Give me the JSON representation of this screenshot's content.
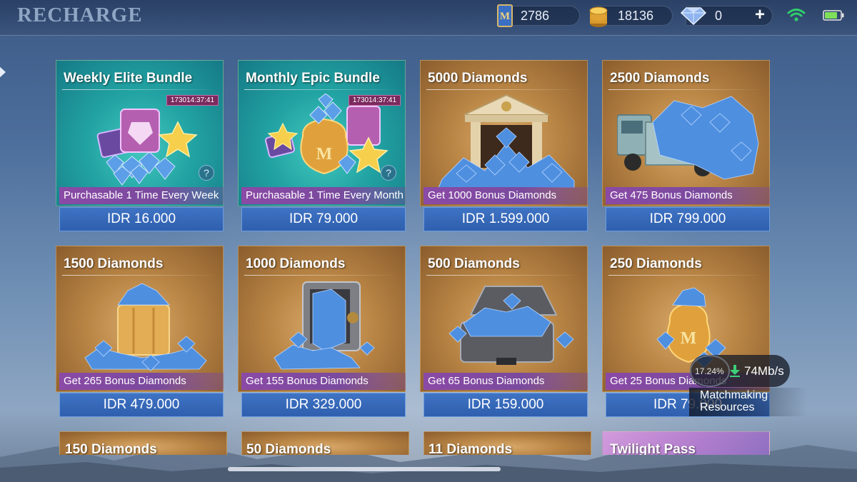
{
  "header": {
    "title": "RECHARGE",
    "currencies": [
      {
        "icon": "m-ticket-icon",
        "value": "2786"
      },
      {
        "icon": "gold-coins-icon",
        "value": "18136"
      },
      {
        "icon": "diamond-icon",
        "value": "0",
        "add_label": "+"
      }
    ]
  },
  "cards": [
    {
      "title": "Weekly Elite Bundle",
      "timer": "173014:37:41",
      "help": "?",
      "bonus": "Purchasable 1 Time Every Week",
      "price": "IDR 16.000",
      "theme": "teal"
    },
    {
      "title": "Monthly Epic Bundle",
      "timer": "173014:37:41",
      "help": "?",
      "bonus": "Purchasable 1 Time Every Month",
      "price": "IDR 79.000",
      "theme": "teal"
    },
    {
      "title": "5000 Diamonds",
      "bonus": "Get 1000 Bonus Diamonds",
      "price": "IDR 1.599.000",
      "theme": "gold"
    },
    {
      "title": "2500 Diamonds",
      "bonus": "Get 475 Bonus Diamonds",
      "price": "IDR 799.000",
      "theme": "gold"
    },
    {
      "title": "1500 Diamonds",
      "bonus": "Get 265 Bonus Diamonds",
      "price": "IDR 479.000",
      "theme": "gold"
    },
    {
      "title": "1000 Diamonds",
      "bonus": "Get 155 Bonus Diamonds",
      "price": "IDR 329.000",
      "theme": "gold"
    },
    {
      "title": "500 Diamonds",
      "bonus": "Get 65 Bonus Diamonds",
      "price": "IDR 159.000",
      "theme": "gold"
    },
    {
      "title": "250 Diamonds",
      "bonus": "Get 25 Bonus Diamonds",
      "price": "IDR 79.000",
      "theme": "gold"
    }
  ],
  "partial_cards": [
    {
      "title": "150 Diamonds"
    },
    {
      "title": "50 Diamonds"
    },
    {
      "title": "11 Diamonds"
    },
    {
      "title": "Twilight Pass"
    }
  ],
  "download": {
    "percent": "17.24%",
    "speed": "74Mb/s",
    "label_line1": "Matchmaking",
    "label_line2": "Resources"
  },
  "colors": {
    "price_button": "#3f73c4",
    "bonus_strip": "#8a4aa6",
    "timer_badge": "#7b2a5e",
    "wifi": "#2fd06a",
    "battery": "#7ee05a"
  }
}
